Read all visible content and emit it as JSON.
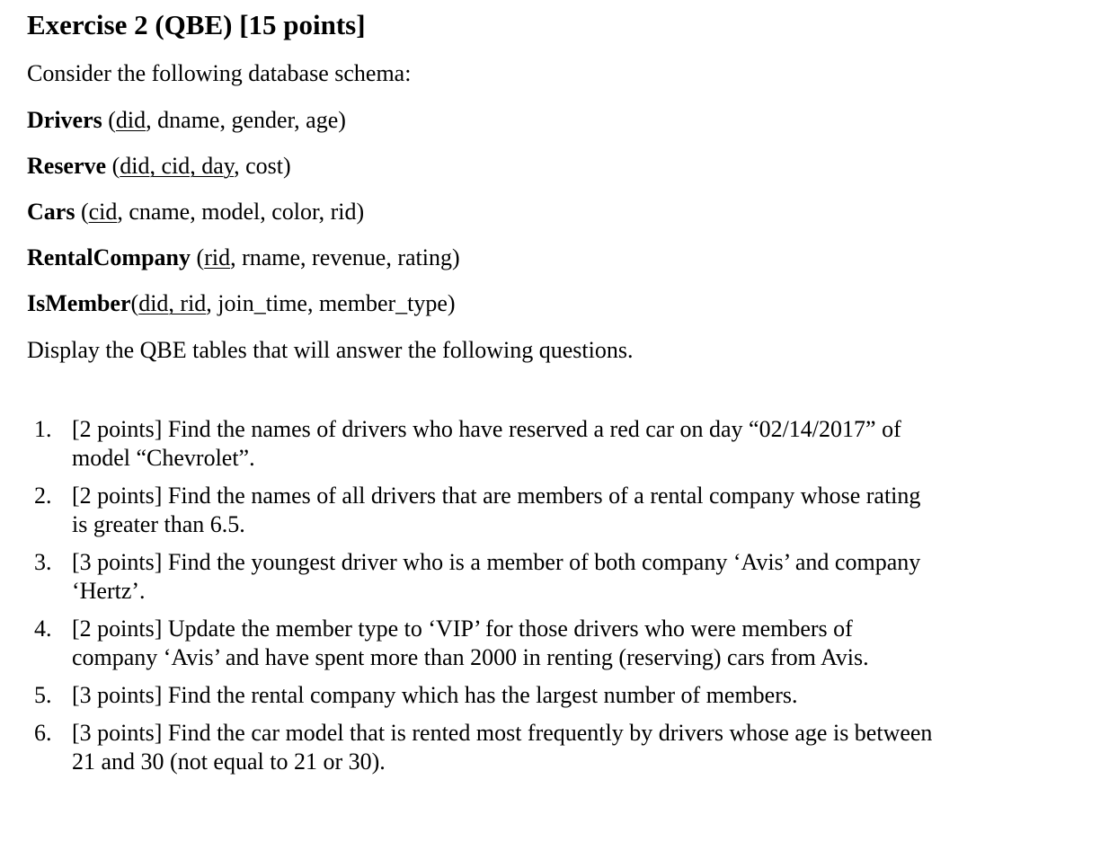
{
  "title": "Exercise 2 (QBE) [15 points]",
  "intro": "Consider the following database schema:",
  "schema": [
    {
      "name": "Drivers",
      "sep": " (",
      "keys": "did",
      "rest": ", dname, gender, age)"
    },
    {
      "name": "Reserve",
      "sep": " (",
      "keys": "did, cid, day",
      "rest": ", cost)"
    },
    {
      "name": "Cars",
      "sep": " (",
      "keys": "cid",
      "rest": ", cname, model, color, rid)"
    },
    {
      "name": "RentalCompany",
      "sep": " (",
      "keys": "rid",
      "rest": ", rname, revenue, rating)"
    },
    {
      "name": "IsMember",
      "sep": "(",
      "keys": "did, rid",
      "rest": ", join_time, member_type)"
    }
  ],
  "instruction": "Display the QBE tables that will answer the following questions.",
  "questions": [
    {
      "num": "1.",
      "text": "[2 points] Find the names of drivers who have reserved a red car on day “02/14/2017” of model “Chevrolet”."
    },
    {
      "num": "2.",
      "text": "[2 points] Find the names of all drivers that are members of a rental company whose rating is greater than 6.5."
    },
    {
      "num": "3.",
      "text": "[3 points] Find the youngest driver who is a member of both company ‘Avis’ and company ‘Hertz’."
    },
    {
      "num": "4.",
      "text": "[2 points] Update the member type to ‘VIP’ for those drivers who were members of company ‘Avis’ and have spent more than 2000 in renting (reserving) cars from Avis."
    },
    {
      "num": "5.",
      "text": "[3 points] Find the rental company which has the largest number of members."
    },
    {
      "num": "6.",
      "text": "[3 points] Find the car model that is rented most frequently by drivers whose age is between 21 and 30 (not equal to 21 or 30)."
    }
  ]
}
